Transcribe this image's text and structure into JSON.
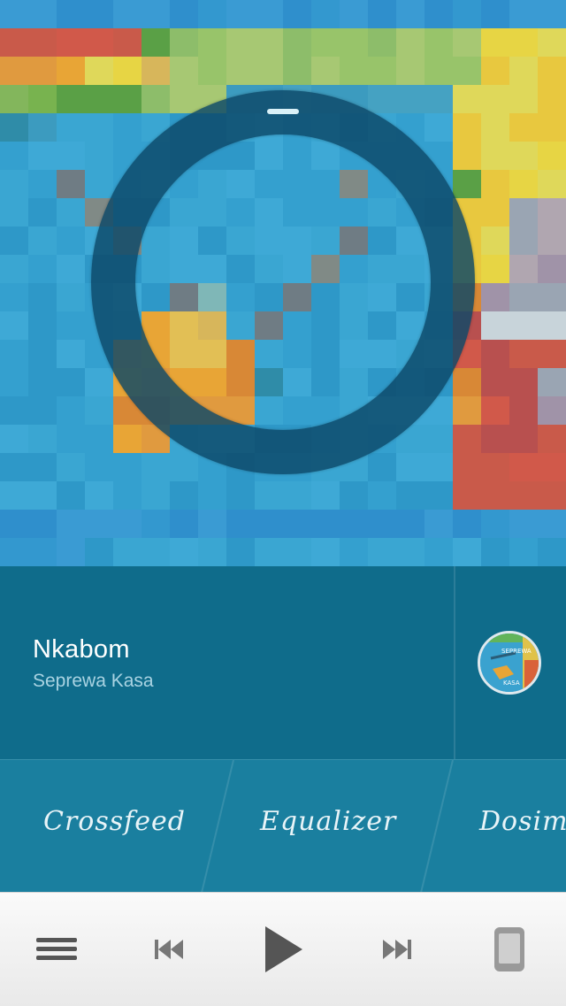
{
  "now_playing": {
    "title": "Nkabom",
    "artist": "Seprewa Kasa",
    "album_art_text": "SEPREWA KASA"
  },
  "features": [
    {
      "label": "Crossfeed"
    },
    {
      "label": "Equalizer"
    },
    {
      "label": "Dosimeter"
    }
  ],
  "toolbar": {
    "icons": [
      "menu-icon",
      "previous-track-icon",
      "play-icon",
      "next-track-icon",
      "device-icon"
    ]
  },
  "colors": {
    "panel": "#0f6c8b",
    "features": "#1a7f9f",
    "ring": "#0c4868",
    "toolbar": "#f2f2f2",
    "icon": "#555555"
  }
}
